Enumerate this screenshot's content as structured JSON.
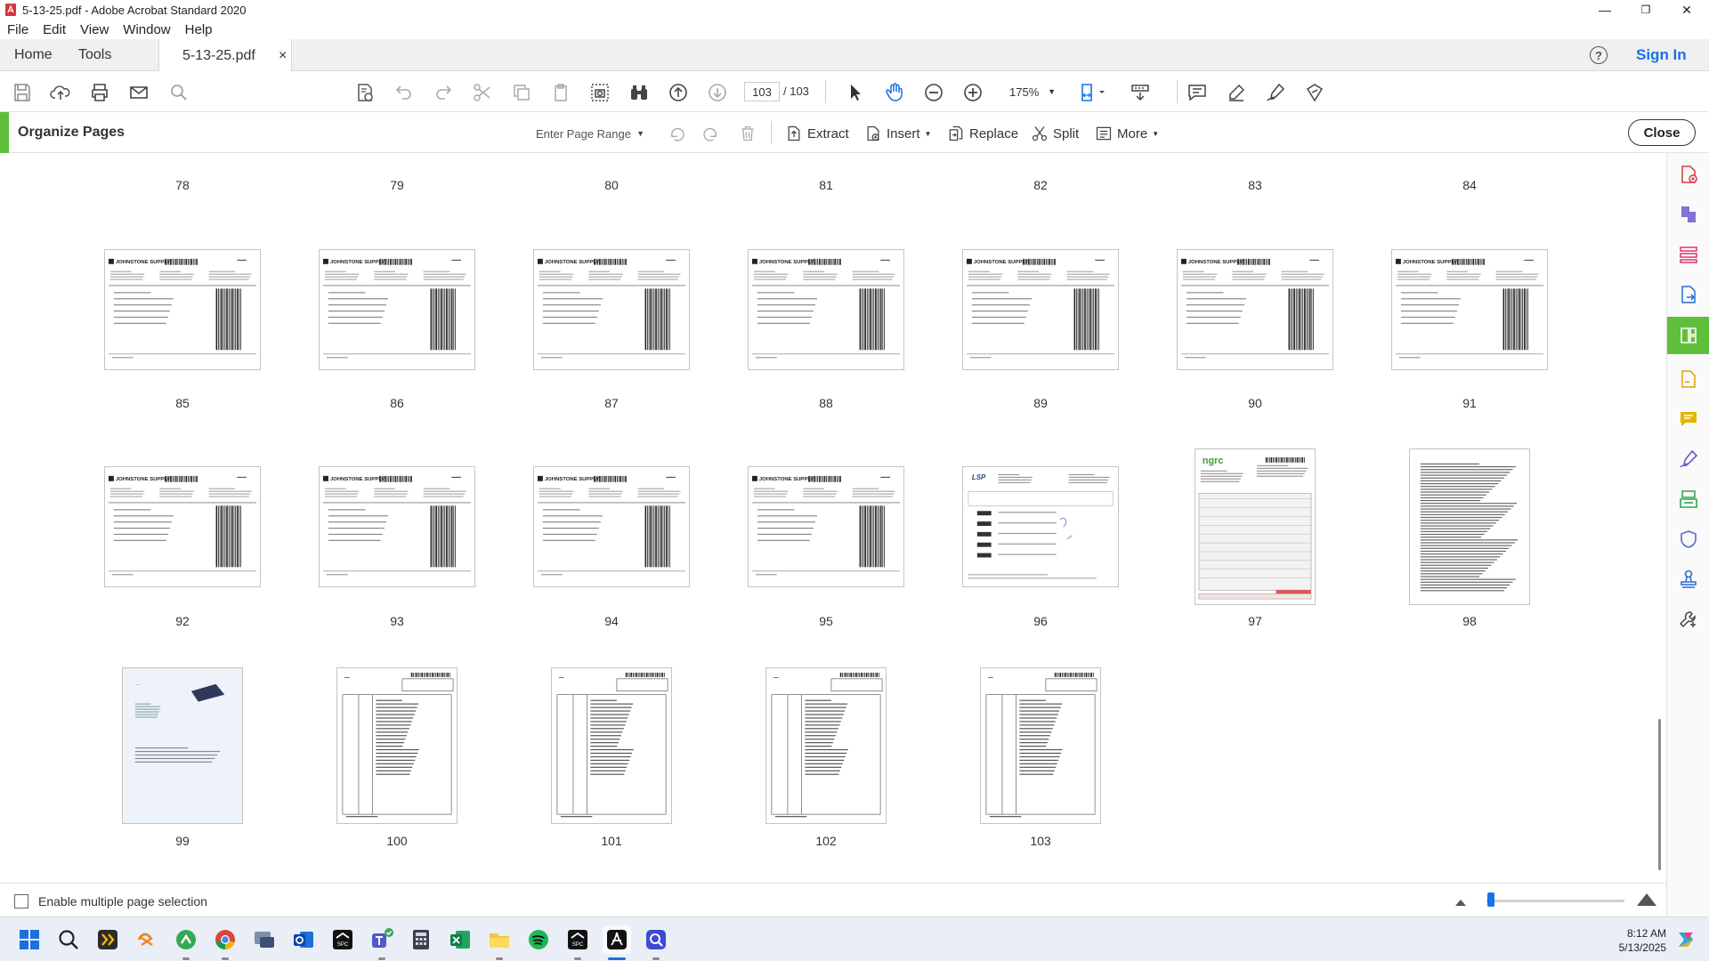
{
  "window": {
    "title": "5-13-25.pdf - Adobe Acrobat Standard 2020",
    "minimize": "—",
    "maximize": "❐",
    "close": "✕"
  },
  "menu": [
    "File",
    "Edit",
    "View",
    "Window",
    "Help"
  ],
  "tabs": {
    "home": "Home",
    "tools": "Tools",
    "document": "5-13-25.pdf",
    "document_close": "×",
    "help": "?",
    "sign_in": "Sign In"
  },
  "toolbar": {
    "current_page": "103",
    "total_pages": "/ 103",
    "zoom": "175%"
  },
  "organize": {
    "title": "Organize Pages",
    "page_range_placeholder": "Enter Page Range",
    "extract": "Extract",
    "insert": "Insert",
    "replace": "Replace",
    "split": "Split",
    "more": "More",
    "close": "Close"
  },
  "pages": {
    "header_row": [
      "78",
      "79",
      "80",
      "81",
      "82",
      "83",
      "84"
    ],
    "rows": [
      {
        "labels": [
          "85",
          "86",
          "87",
          "88",
          "89",
          "90",
          "91"
        ],
        "types": [
          "johnstone",
          "johnstone",
          "johnstone",
          "johnstone",
          "johnstone",
          "johnstone",
          "johnstone"
        ]
      },
      {
        "labels": [
          "92",
          "93",
          "94",
          "95",
          "96",
          "97",
          "98"
        ],
        "types": [
          "johnstone",
          "johnstone",
          "johnstone",
          "johnstone",
          "form",
          "packing",
          "text"
        ]
      },
      {
        "labels": [
          "99",
          "100",
          "101",
          "102",
          "103"
        ],
        "types": [
          "letter",
          "delivery",
          "delivery",
          "delivery",
          "delivery"
        ]
      }
    ],
    "thumb_logo_text": "JOHNSTONE SUPPLY"
  },
  "status": {
    "multi_select_label": "Enable multiple page selection"
  },
  "taskbar": {
    "apps": [
      "windows-start",
      "search",
      "app-a",
      "app-b",
      "app-c",
      "chrome",
      "app-d",
      "outlook",
      "spc",
      "teams",
      "calculator",
      "excel",
      "file-explorer",
      "spotify",
      "spc2",
      "acrobat",
      "app-e"
    ],
    "time": "8:12 AM",
    "date": "5/13/2025"
  },
  "colors": {
    "accent_green": "#5fbf3a",
    "link_blue": "#1473e6"
  }
}
